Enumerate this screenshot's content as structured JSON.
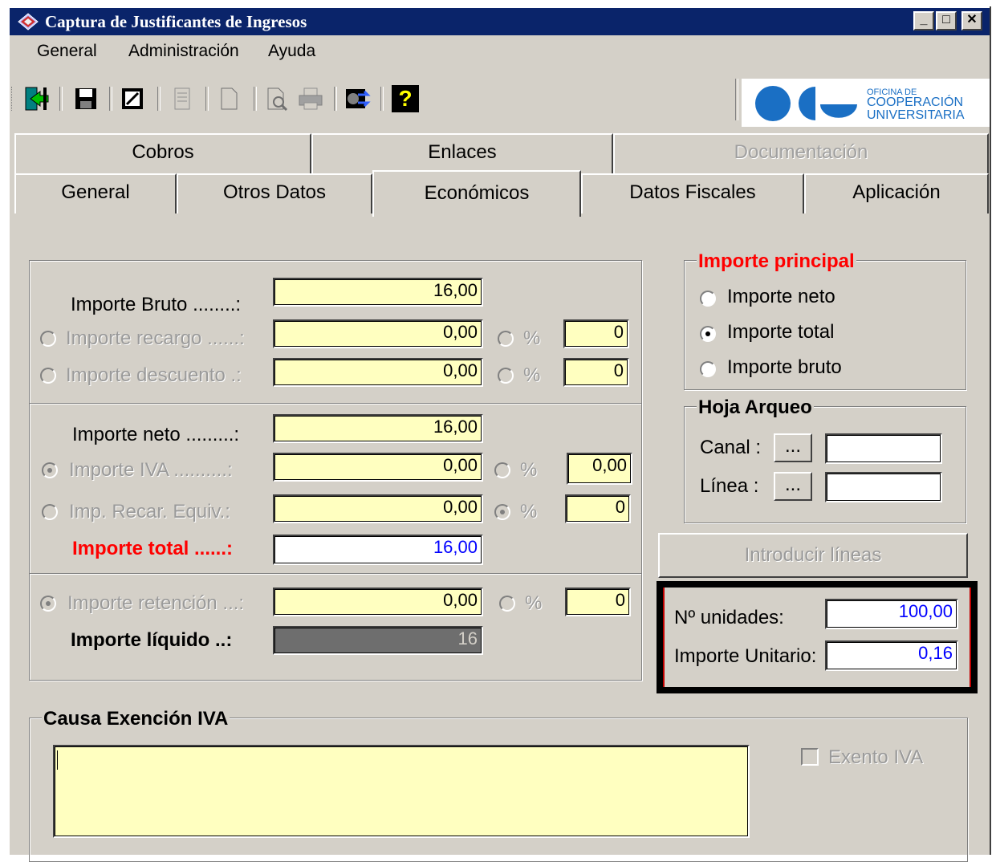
{
  "window": {
    "title": "Captura de Justificantes de Ingresos",
    "minimize_glyph": "_",
    "maximize_glyph": "□",
    "close_glyph": "✕"
  },
  "menu": [
    "General",
    "Administración",
    "Ayuda"
  ],
  "toolbar": {
    "icons": [
      "exit-icon",
      "save-icon",
      "edit-icon",
      "document-icon",
      "new-page-icon",
      "print-preview-icon",
      "print-icon",
      "exchange-icon",
      "help-icon"
    ],
    "help_glyph": "?"
  },
  "logo": {
    "line1": "OFICINA DE",
    "line2": "COOPERACIÓN",
    "line3": "UNIVERSITARIA",
    "color": "#1a6fc4"
  },
  "tabs_row1": [
    {
      "label": "Cobros",
      "enabled": true
    },
    {
      "label": "Enlaces",
      "enabled": true
    },
    {
      "label": "Documentación",
      "enabled": false
    }
  ],
  "tabs_row2": [
    {
      "label": "General",
      "active": false
    },
    {
      "label": "Otros Datos",
      "active": false
    },
    {
      "label": "Económicos",
      "active": true
    },
    {
      "label": "Datos Fiscales",
      "active": false
    },
    {
      "label": "Aplicación",
      "active": false
    }
  ],
  "amounts": {
    "bruto_label": "Importe Bruto ........:",
    "bruto_value": "16,00",
    "recargo_label": "Importe recargo ......:",
    "recargo_value": "0,00",
    "recargo_pct_label": "%",
    "recargo_pct": "0",
    "descuento_label": "Importe descuento .:",
    "descuento_value": "0,00",
    "descuento_pct_label": "%",
    "descuento_pct": "0",
    "neto_label": "Importe neto .........:",
    "neto_value": "16,00",
    "iva_label": "Importe IVA ..........:",
    "iva_value": "0,00",
    "iva_pct_label": "%",
    "iva_pct": "0,00",
    "recargo_equiv_label": "Imp. Recar. Equiv.:",
    "recargo_equiv_value": "0,00",
    "recargo_equiv_pct_label": "%",
    "recargo_equiv_pct": "0",
    "total_label": "Importe total ......:",
    "total_value": "16,00",
    "retencion_label": "Importe retención ...:",
    "retencion_value": "0,00",
    "retencion_pct_label": "%",
    "retencion_pct": "0",
    "liquido_label": "Importe líquido ..:",
    "liquido_value": "16"
  },
  "importe_principal": {
    "title": "Importe principal",
    "options": [
      {
        "label": "Importe neto",
        "checked": false
      },
      {
        "label": "Importe total",
        "checked": true
      },
      {
        "label": "Importe bruto",
        "checked": false
      }
    ]
  },
  "hoja_arqueo": {
    "title": "Hoja Arqueo",
    "canal_label": "Canal :",
    "canal_button": "...",
    "canal_value": "",
    "linea_label": "Línea :",
    "linea_button": "...",
    "linea_value": ""
  },
  "introducir_lineas": "Introducir líneas",
  "unidades": {
    "unidades_label": "Nº unidades:",
    "unidades_value": "100,00",
    "unitario_label": "Importe Unitario:",
    "unitario_value": "0,16"
  },
  "exencion": {
    "title": "Causa Exención IVA",
    "text": "",
    "exento_label": "Exento IVA",
    "exento_checked": false
  }
}
